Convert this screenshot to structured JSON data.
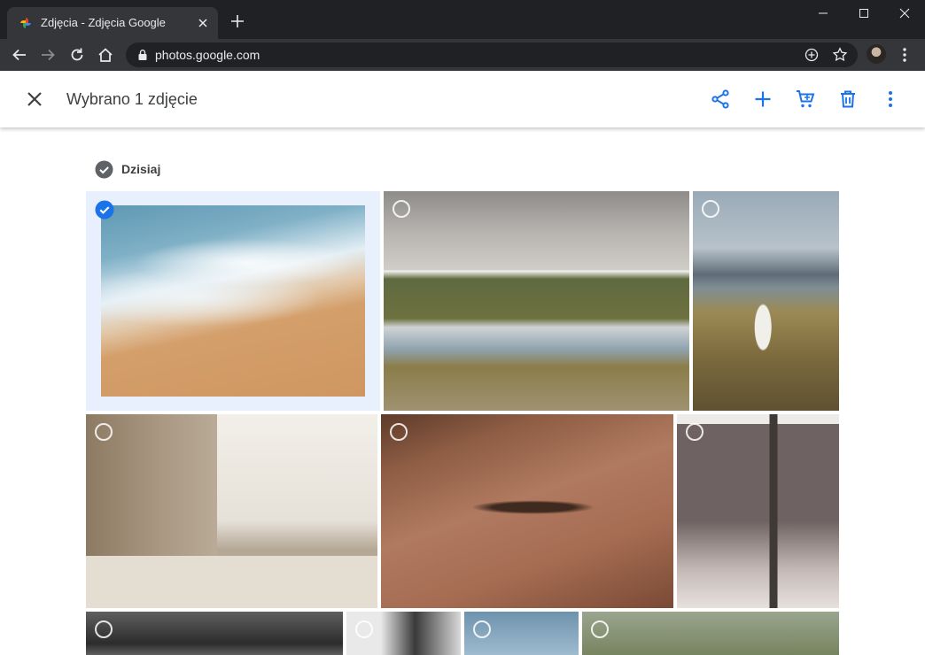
{
  "browser": {
    "tab_title": "Zdjęcia - Zdjęcia Google",
    "url": "photos.google.com"
  },
  "header": {
    "selection_text": "Wybrano 1 zdjęcie",
    "actions": [
      "share-icon",
      "add-icon",
      "cart-icon",
      "delete-icon",
      "more-icon"
    ],
    "accent_color": "#1a73e8"
  },
  "section": {
    "date_label": "Dzisiaj"
  },
  "photos": [
    {
      "subject": "beach-waves",
      "selected": true
    },
    {
      "subject": "mountain-lake",
      "selected": false
    },
    {
      "subject": "woman-in-field",
      "selected": false
    },
    {
      "subject": "louvre",
      "selected": false
    },
    {
      "subject": "freckled-face",
      "selected": false
    },
    {
      "subject": "cactus-polaroid",
      "selected": false
    },
    {
      "subject": "ocean-waves",
      "selected": false
    },
    {
      "subject": "bw-portrait",
      "selected": false
    },
    {
      "subject": "sky",
      "selected": false
    },
    {
      "subject": "grass-field",
      "selected": false
    }
  ]
}
